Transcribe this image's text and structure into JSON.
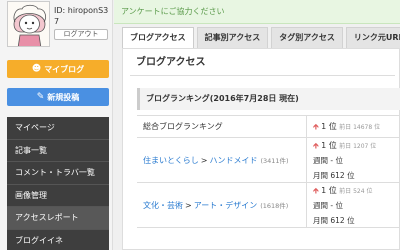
{
  "profile": {
    "user_id": "ID: hiroponS37",
    "logout_label": "ログアウト"
  },
  "sidebar": {
    "myblog_label": "マイブログ",
    "newpost_label": "新規投稿",
    "items": [
      {
        "label": "マイページ"
      },
      {
        "label": "記事一覧"
      },
      {
        "label": "コメント・トラバ一覧"
      },
      {
        "label": "画像管理"
      },
      {
        "label": "アクセスレポート"
      },
      {
        "label": "ブログイイネ"
      }
    ]
  },
  "notice": {
    "text": "アンケートにご協力ください"
  },
  "tabs": [
    {
      "label": "ブログアクセス"
    },
    {
      "label": "記事別アクセス"
    },
    {
      "label": "タグ別アクセス"
    },
    {
      "label": "リンク元URL"
    }
  ],
  "content": {
    "title": "ブログアクセス",
    "ranking_header": "ブログランキング(2016年7月28日 現在)",
    "rows": [
      {
        "label": "総合ブログランキング",
        "rank_up": "1 位",
        "rank_prev": "前日 14678 位"
      },
      {
        "cat1": "住まいとくらし",
        "sep": ">",
        "cat2": "ハンドメイド",
        "count": "(3411件)",
        "rank_up": "1 位",
        "rank_prev": "前日 1207 位",
        "weekly": "週間 - 位",
        "monthly": "月間 612 位"
      },
      {
        "cat1": "文化・芸術",
        "sep": ">",
        "cat2": "アート・デザイン",
        "count": "(1618件)",
        "rank_up": "1 位",
        "rank_prev": "前日 524 位",
        "weekly": "週間 - 位",
        "monthly": "月間 612 位"
      }
    ]
  },
  "colors": {
    "myblog": "#f6ad2a",
    "newpost": "#4a90e2",
    "menu_bg": "#3e3e3e",
    "link": "#2a7bd0",
    "up_arrow": "#e06060"
  }
}
